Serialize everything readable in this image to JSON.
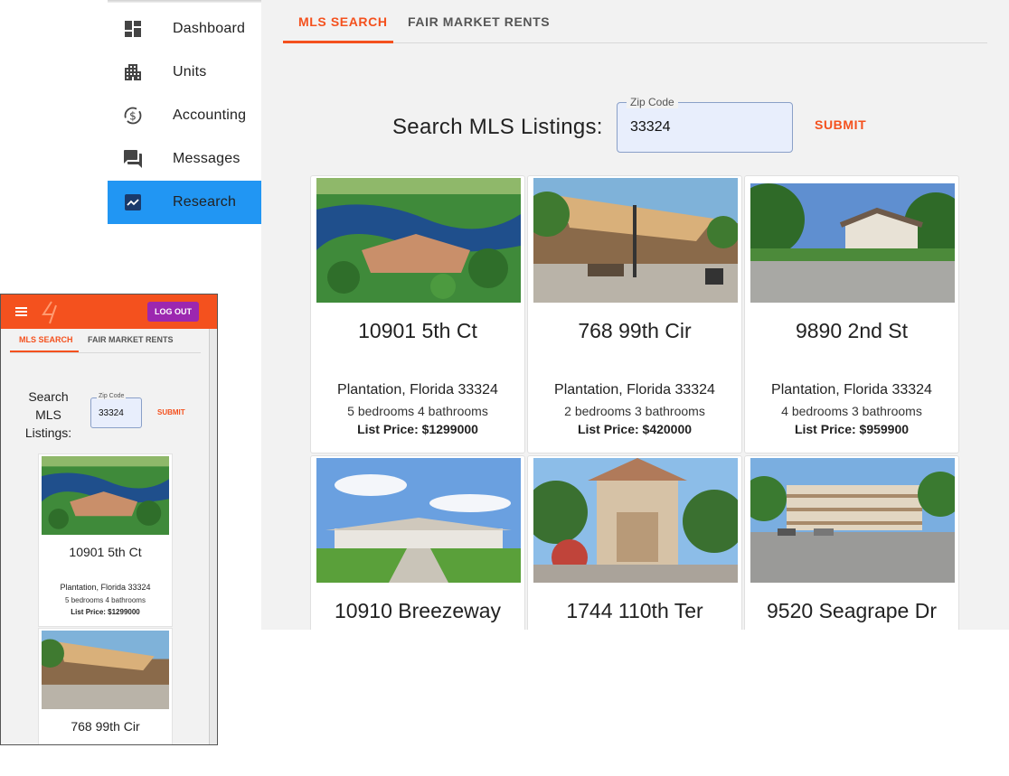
{
  "sidebar": {
    "items": [
      {
        "label": "Dashboard",
        "icon": "dashboard-icon"
      },
      {
        "label": "Units",
        "icon": "apartment-icon"
      },
      {
        "label": "Accounting",
        "icon": "currency-exchange-icon"
      },
      {
        "label": "Messages",
        "icon": "forum-icon"
      },
      {
        "label": "Research",
        "icon": "insights-icon",
        "active": true
      }
    ]
  },
  "tabs": [
    {
      "label": "MLS SEARCH",
      "active": true
    },
    {
      "label": "FAIR MARKET RENTS",
      "active": false
    }
  ],
  "search": {
    "label": "Search MLS Listings:",
    "zip_label": "Zip Code",
    "zip_value": "33324",
    "submit_label": "SUBMIT"
  },
  "listings": [
    {
      "address": "10901 5th Ct",
      "city": "Plantation, Florida 33324",
      "beds": "5 bedrooms 4 bathrooms",
      "price": "List Price: $1299000"
    },
    {
      "address": "768 99th Cir",
      "city": "Plantation, Florida 33324",
      "beds": "2 bedrooms 3 bathrooms",
      "price": "List Price: $420000"
    },
    {
      "address": "9890 2nd St",
      "city": "Plantation, Florida 33324",
      "beds": "4 bedrooms 3 bathrooms",
      "price": "List Price: $959900"
    },
    {
      "address": "10910 Breezeway"
    },
    {
      "address": "1744 110th Ter"
    },
    {
      "address": "9520 Seagrape Dr"
    }
  ],
  "mobile": {
    "logout_label": "LOG OUT",
    "menu_icon": "menu-icon",
    "logo_icon": "logo-icon",
    "tabs": [
      "MLS SEARCH",
      "FAIR MARKET RENTS"
    ],
    "search_label_lines": [
      "Search",
      "MLS",
      "Listings:"
    ],
    "zip_label": "Zip Code",
    "zip_value": "33324",
    "submit_label": "SUBMIT",
    "listings": [
      {
        "address": "10901 5th Ct",
        "city": "Plantation, Florida 33324",
        "beds": "5 bedrooms 4 bathrooms",
        "price": "List Price: $1299000"
      },
      {
        "address": "768 99th Cir"
      }
    ]
  },
  "colors": {
    "accent": "#f4511e",
    "active_nav": "#2196f3",
    "logout": "#9c27b0"
  }
}
